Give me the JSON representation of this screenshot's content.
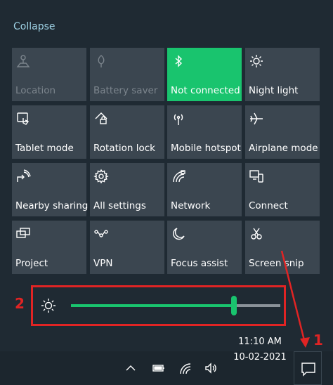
{
  "panel": {
    "collapse_label": "Collapse",
    "tiles": [
      {
        "label": "Location",
        "icon": "location-icon",
        "state": "disabled"
      },
      {
        "label": "Battery saver",
        "icon": "battery-saver-icon",
        "state": "disabled"
      },
      {
        "label": "Not connected",
        "icon": "bluetooth-icon",
        "state": "active"
      },
      {
        "label": "Night light",
        "icon": "night-light-icon",
        "state": "normal"
      },
      {
        "label": "Tablet mode",
        "icon": "tablet-mode-icon",
        "state": "normal"
      },
      {
        "label": "Rotation lock",
        "icon": "rotation-lock-icon",
        "state": "normal"
      },
      {
        "label": "Mobile hotspot",
        "icon": "mobile-hotspot-icon",
        "state": "normal"
      },
      {
        "label": "Airplane mode",
        "icon": "airplane-icon",
        "state": "normal"
      },
      {
        "label": "Nearby sharing",
        "icon": "nearby-sharing-icon",
        "state": "normal"
      },
      {
        "label": "All settings",
        "icon": "gear-icon",
        "state": "normal"
      },
      {
        "label": "Network",
        "icon": "network-icon",
        "state": "normal"
      },
      {
        "label": "Connect",
        "icon": "connect-icon",
        "state": "normal"
      },
      {
        "label": "Project",
        "icon": "project-icon",
        "state": "normal"
      },
      {
        "label": "VPN",
        "icon": "vpn-icon",
        "state": "normal"
      },
      {
        "label": "Focus assist",
        "icon": "moon-icon",
        "state": "normal"
      },
      {
        "label": "Screen snip",
        "icon": "screen-snip-icon",
        "state": "normal"
      }
    ]
  },
  "brightness": {
    "icon": "brightness-sun-icon",
    "level": 0.78
  },
  "annotations": {
    "label_1": "1",
    "label_2": "2"
  },
  "taskbar": {
    "time": "11:10 AM",
    "date": "10-02-2021",
    "icons": [
      "chevron-up-icon",
      "battery-icon",
      "wifi-icon",
      "volume-icon"
    ],
    "notification_icon": "action-center-icon"
  },
  "colors": {
    "background": "#1f2a33",
    "tile": "#3b4650",
    "accent": "#19c46e",
    "annotation": "#e02424",
    "collapse_text": "#9fd3e6"
  }
}
